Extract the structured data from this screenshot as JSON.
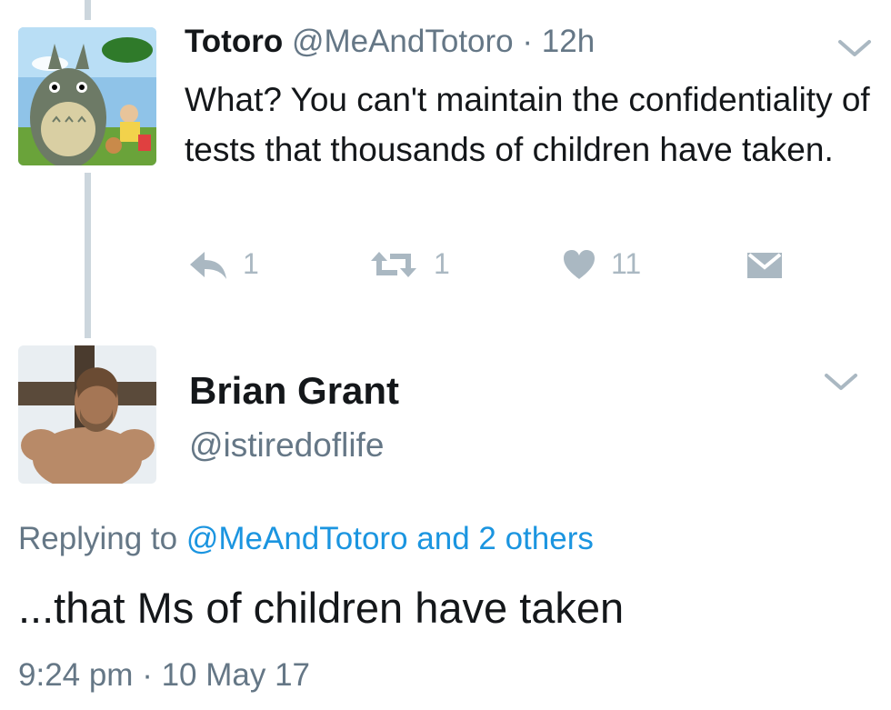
{
  "tweet1": {
    "display_name": "Totoro",
    "handle": "@MeAndTotoro",
    "separator": "·",
    "time": "12h",
    "text": "What? You can't maintain the confidentiality of tests that thousands of children have taken.",
    "reply_count": "1",
    "retweet_count": "1",
    "like_count": "11",
    "avatar_icon": "totoro-avatar",
    "menu_icon": "chevron-down-icon"
  },
  "tweet2": {
    "display_name": "Brian Grant",
    "handle": "@istiredoflife",
    "replying_prefix": "Replying to",
    "replying_target": "@MeAndTotoro and 2 others",
    "text": "...that Ms of children have taken",
    "time": "9:24 pm",
    "separator": "·",
    "date": "10 May 17",
    "avatar_icon": "man-avatar",
    "menu_icon": "chevron-down-icon"
  },
  "colors": {
    "text_primary": "#14171a",
    "text_secondary": "#657786",
    "link": "#1b95e0",
    "action_icon": "#aab8c2",
    "thread_line": "#ccd6dd"
  }
}
